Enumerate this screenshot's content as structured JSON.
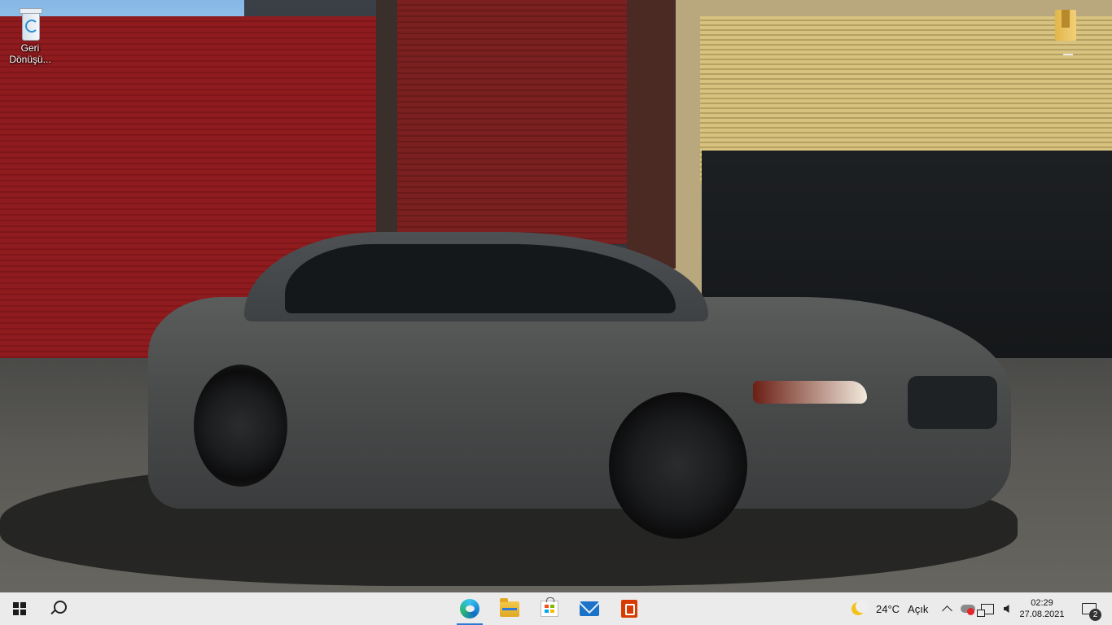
{
  "desktop": {
    "icons": [
      {
        "label": "Geri Dönüşü...",
        "icon": "recycle-bin-icon"
      }
    ]
  },
  "taskbar": {
    "start": {
      "icon": "windows-start-icon"
    },
    "search": {
      "icon": "search-icon"
    },
    "pinned": [
      {
        "icon": "edge-browser-icon",
        "active": true
      },
      {
        "icon": "file-explorer-icon",
        "active": false
      },
      {
        "icon": "microsoft-store-icon",
        "active": false
      },
      {
        "icon": "mail-icon",
        "active": false
      },
      {
        "icon": "office-icon",
        "active": false
      }
    ],
    "weather": {
      "icon": "crescent-moon-icon",
      "temperature": "24°C",
      "condition": "Açık"
    },
    "tray": {
      "chevron_icon": "chevron-up-icon",
      "icons": [
        "onedrive-error-icon",
        "network-icon",
        "volume-icon"
      ]
    },
    "clock": {
      "time": "02:29",
      "date": "27.08.2021"
    },
    "notifications": {
      "icon": "notification-center-icon",
      "count": "2"
    }
  },
  "colors": {
    "taskbar_bg": "#eeeeee",
    "accent": "#2c7ad6"
  }
}
